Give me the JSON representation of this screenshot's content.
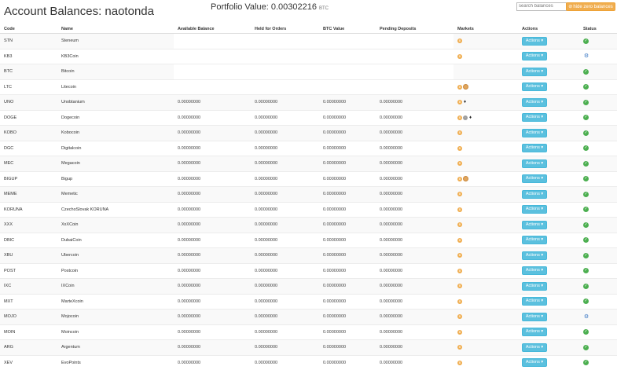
{
  "header": {
    "title": "Account Balances: naotonda",
    "portfolio_label": "Portfolio Value: 0.00302216",
    "portfolio_unit": "BTC",
    "search_placeholder": "search balances",
    "hide_zero_label": "hide zero balances"
  },
  "columns": [
    "Code",
    "Name",
    "Available Balance",
    "Held for Orders",
    "BTC Value",
    "Pending Deposits",
    "Markets",
    "Actions",
    "Status"
  ],
  "actions_label": "Actions ▾",
  "rows": [
    {
      "code": "STN",
      "name": "Steneum",
      "avail": "",
      "held": "",
      "btc": "",
      "pending": "",
      "markets": [
        "orange"
      ],
      "status": "ok"
    },
    {
      "code": "KB3",
      "name": "KB3Coin",
      "avail": "",
      "held": "",
      "btc": "",
      "pending": "",
      "markets": [
        "orange"
      ],
      "status": "sync"
    },
    {
      "code": "BTC",
      "name": "Bitcoin",
      "avail": "",
      "held": "",
      "btc": "",
      "pending": "",
      "markets": [],
      "status": "ok"
    },
    {
      "code": "LTC",
      "name": "Litecoin",
      "avail": "",
      "held": "",
      "btc": "",
      "pending": "",
      "markets": [
        "orange",
        "tan"
      ],
      "status": "ok"
    },
    {
      "code": "UNO",
      "name": "Unobtanium",
      "avail": "0.00000000",
      "held": "0.00000000",
      "btc": "0.00000000",
      "pending": "0.00000000",
      "markets": [
        "orange",
        "diamond"
      ],
      "status": "ok"
    },
    {
      "code": "DOGE",
      "name": "Dogecoin",
      "avail": "0.00000000",
      "held": "0.00000000",
      "btc": "0.00000000",
      "pending": "0.00000000",
      "markets": [
        "orange",
        "grey",
        "diamond"
      ],
      "status": "ok"
    },
    {
      "code": "KOBO",
      "name": "Kobocoin",
      "avail": "0.00000000",
      "held": "0.00000000",
      "btc": "0.00000000",
      "pending": "0.00000000",
      "markets": [
        "orange"
      ],
      "status": "ok"
    },
    {
      "code": "DGC",
      "name": "Digitalcoin",
      "avail": "0.00000000",
      "held": "0.00000000",
      "btc": "0.00000000",
      "pending": "0.00000000",
      "markets": [
        "orange"
      ],
      "status": "ok"
    },
    {
      "code": "MEC",
      "name": "Megacoin",
      "avail": "0.00000000",
      "held": "0.00000000",
      "btc": "0.00000000",
      "pending": "0.00000000",
      "markets": [
        "orange"
      ],
      "status": "ok"
    },
    {
      "code": "BIGUP",
      "name": "Bigup",
      "avail": "0.00000000",
      "held": "0.00000000",
      "btc": "0.00000000",
      "pending": "0.00000000",
      "markets": [
        "orange",
        "tan"
      ],
      "status": "ok"
    },
    {
      "code": "MEME",
      "name": "Memetic",
      "avail": "0.00000000",
      "held": "0.00000000",
      "btc": "0.00000000",
      "pending": "0.00000000",
      "markets": [
        "orange"
      ],
      "status": "ok"
    },
    {
      "code": "KORUNA",
      "name": "CzechoSlovak KORUNA",
      "avail": "0.00000000",
      "held": "0.00000000",
      "btc": "0.00000000",
      "pending": "0.00000000",
      "markets": [
        "orange"
      ],
      "status": "ok"
    },
    {
      "code": "XXX",
      "name": "XxXCoin",
      "avail": "0.00000000",
      "held": "0.00000000",
      "btc": "0.00000000",
      "pending": "0.00000000",
      "markets": [
        "orange"
      ],
      "status": "ok"
    },
    {
      "code": "DBIC",
      "name": "DubaiCoin",
      "avail": "0.00000000",
      "held": "0.00000000",
      "btc": "0.00000000",
      "pending": "0.00000000",
      "markets": [
        "orange"
      ],
      "status": "ok"
    },
    {
      "code": "XBU",
      "name": "Ubercoin",
      "avail": "0.00000000",
      "held": "0.00000000",
      "btc": "0.00000000",
      "pending": "0.00000000",
      "markets": [
        "orange"
      ],
      "status": "ok"
    },
    {
      "code": "POST",
      "name": "Postcoin",
      "avail": "0.00000000",
      "held": "0.00000000",
      "btc": "0.00000000",
      "pending": "0.00000000",
      "markets": [
        "orange"
      ],
      "status": "ok"
    },
    {
      "code": "IXC",
      "name": "IXCoin",
      "avail": "0.00000000",
      "held": "0.00000000",
      "btc": "0.00000000",
      "pending": "0.00000000",
      "markets": [
        "orange"
      ],
      "status": "ok"
    },
    {
      "code": "MXT",
      "name": "MarteXcoin",
      "avail": "0.00000000",
      "held": "0.00000000",
      "btc": "0.00000000",
      "pending": "0.00000000",
      "markets": [
        "orange"
      ],
      "status": "ok"
    },
    {
      "code": "MOJO",
      "name": "Mojocoin",
      "avail": "0.00000000",
      "held": "0.00000000",
      "btc": "0.00000000",
      "pending": "0.00000000",
      "markets": [
        "orange"
      ],
      "status": "sync"
    },
    {
      "code": "MOIN",
      "name": "Moincoin",
      "avail": "0.00000000",
      "held": "0.00000000",
      "btc": "0.00000000",
      "pending": "0.00000000",
      "markets": [
        "orange"
      ],
      "status": "ok"
    },
    {
      "code": "ARG",
      "name": "Argentum",
      "avail": "0.00000000",
      "held": "0.00000000",
      "btc": "0.00000000",
      "pending": "0.00000000",
      "markets": [
        "orange"
      ],
      "status": "ok"
    },
    {
      "code": "XEV",
      "name": "EvoPoints",
      "avail": "0.00000000",
      "held": "0.00000000",
      "btc": "0.00000000",
      "pending": "0.00000000",
      "markets": [
        "orange"
      ],
      "status": "ok"
    }
  ]
}
